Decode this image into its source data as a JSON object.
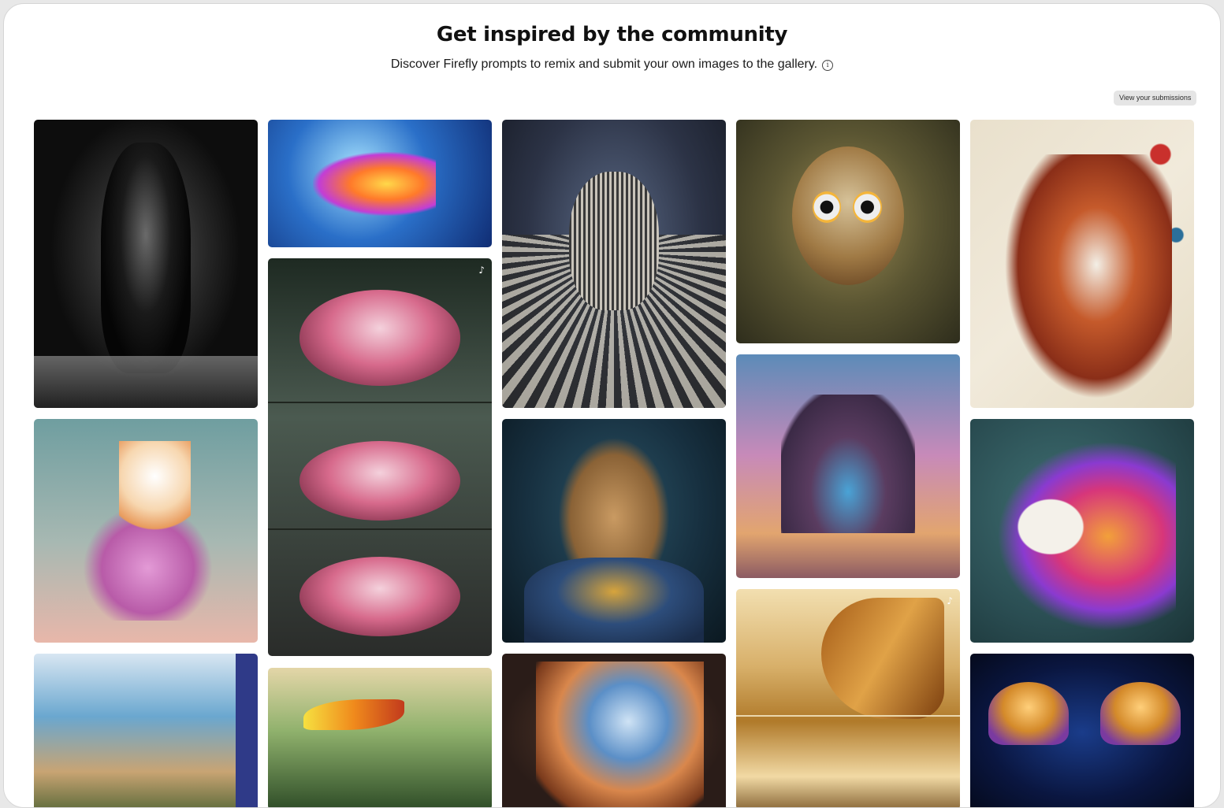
{
  "header": {
    "title": "Get inspired by the community",
    "subtitle": "Discover Firefly prompts to remix and submit your own images to the gallery.",
    "info_icon": "i"
  },
  "actions": {
    "view_submissions_label": "View your submissions"
  },
  "gallery": {
    "items": [
      {
        "name": "black-panther-figurine-image",
        "badge": ""
      },
      {
        "name": "goldfish-bubbles-image",
        "badge": ""
      },
      {
        "name": "zebra-bull-image",
        "badge": ""
      },
      {
        "name": "spiky-bird-creature-image",
        "badge": ""
      },
      {
        "name": "paper-squirrel-image",
        "badge": ""
      },
      {
        "name": "cat-on-scooter-image",
        "badge": ""
      },
      {
        "name": "sleeping-animals-collage-image",
        "badge": "♪"
      },
      {
        "name": "rabbit-in-uniform-image",
        "badge": ""
      },
      {
        "name": "floating-island-waterfall-image",
        "badge": ""
      },
      {
        "name": "candy-unicorn-image",
        "badge": ""
      },
      {
        "name": "desert-fabric-collage-image",
        "badge": "♪"
      },
      {
        "name": "paper-coastline-diorama-image",
        "badge": ""
      },
      {
        "name": "toucans-image",
        "badge": ""
      },
      {
        "name": "spiral-shell-image",
        "badge": ""
      },
      {
        "name": "glowing-jellyfish-image",
        "badge": ""
      }
    ]
  },
  "colors": {
    "page_background": "#ffffff",
    "button_background": "#e5e5e5",
    "text": "#111111"
  }
}
